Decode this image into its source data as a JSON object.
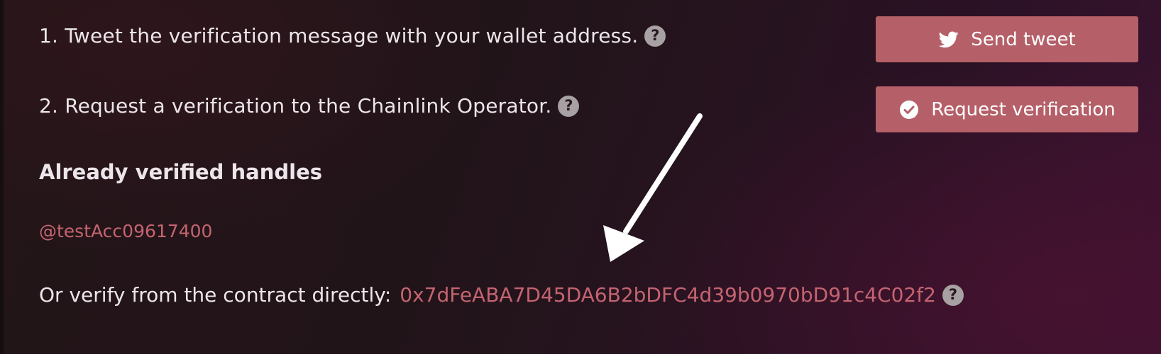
{
  "steps": {
    "step1_text": "1. Tweet the verification message with your wallet address.",
    "step2_text": "2. Request a verification to the Chainlink Operator.",
    "help_glyph": "?"
  },
  "buttons": {
    "send_tweet_label": "Send tweet",
    "request_verification_label": "Request verification"
  },
  "verified": {
    "heading": "Already verified handles",
    "handles": [
      "@testAcc09617400"
    ]
  },
  "contract": {
    "label": "Or verify from the contract directly:",
    "address": "0x7dFeABA7D45DA6B2bDFC4d39b0970bD91c4C02f2"
  },
  "colors": {
    "accent": "#b55f68",
    "link": "#c46470",
    "text": "#ece6ea",
    "help_icon_bg": "#a7a1a4",
    "annotation_arrow": "#ffffff"
  },
  "icons": {
    "help": "question-circle-icon",
    "tweet": "twitter-bird-icon",
    "verify": "check-circle-icon",
    "annotation": "arrow-annotation-icon"
  }
}
